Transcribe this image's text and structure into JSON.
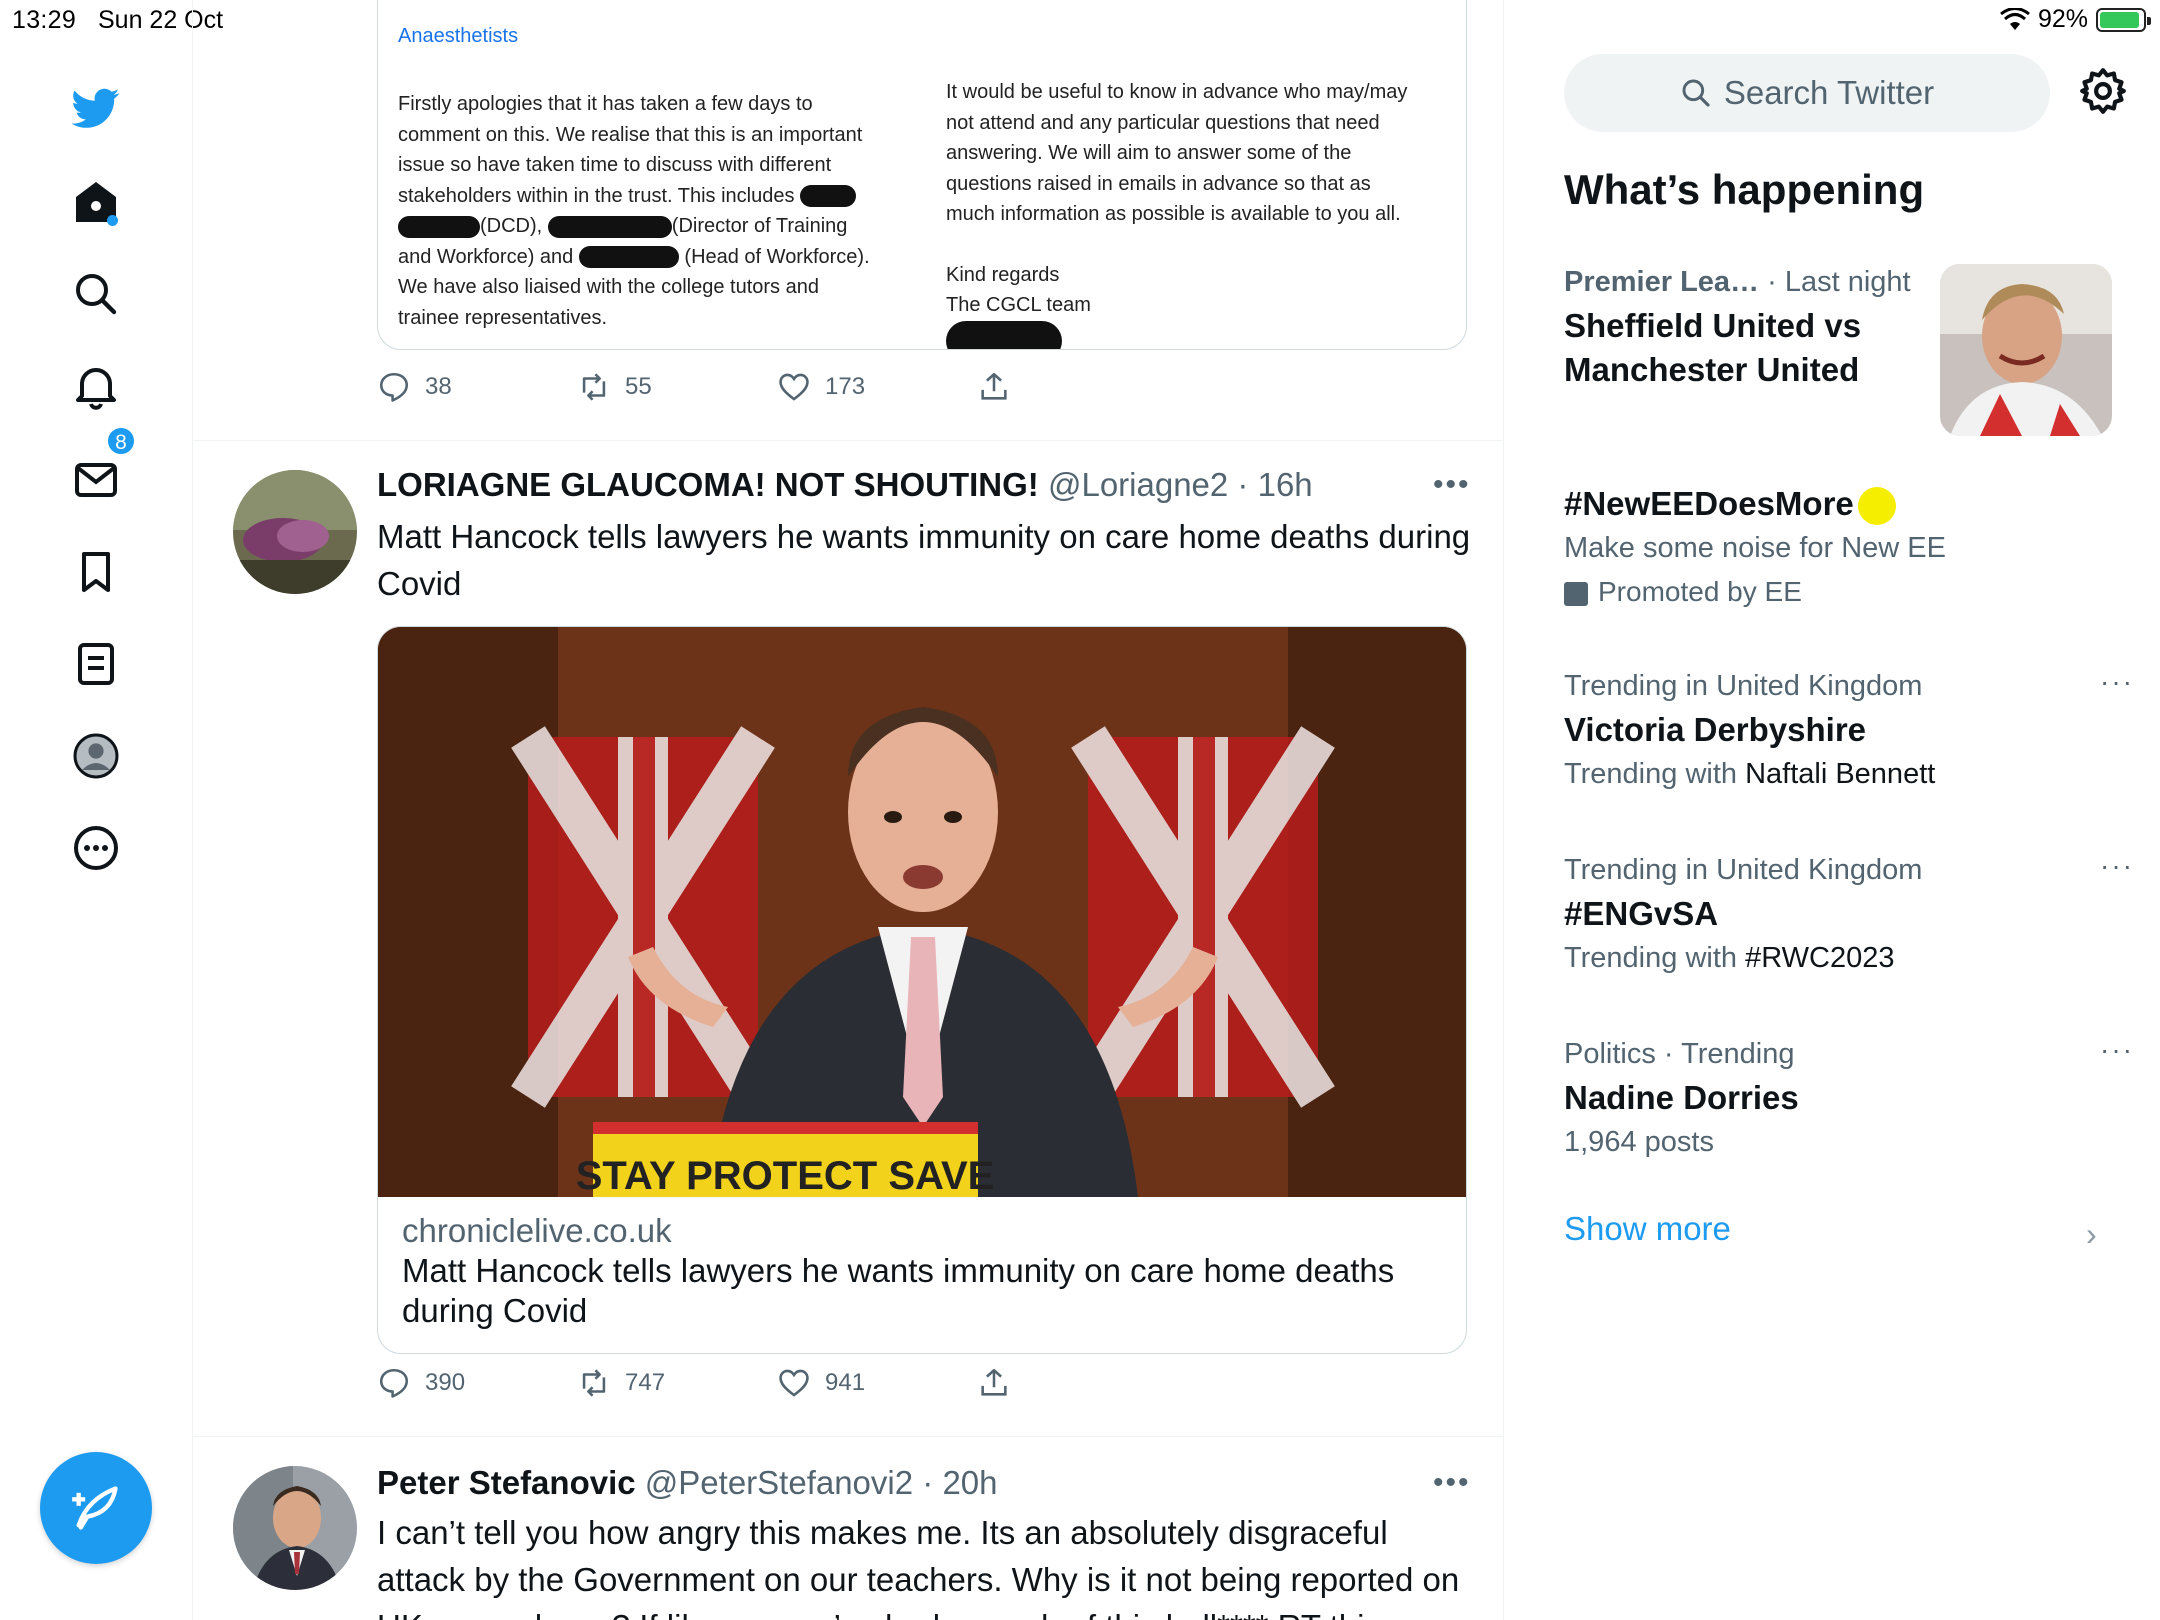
{
  "status_bar": {
    "time": "13:29",
    "date": "Sun 22 Oct",
    "battery": "92%"
  },
  "nav": {
    "notifications_badge": "8"
  },
  "doc": {
    "cut_top_left": "Anaesthetists",
    "left_1": "Firstly apologies that it has taken a few days to",
    "left_2": "comment on this. We realise that this is an important",
    "left_3": "issue so have taken time to discuss with different",
    "left_4": "stakeholders within in the trust. This includes",
    "left_5a": "(DCD),",
    "left_5b": "(Director of Training",
    "left_6a": "and Workforce) and",
    "left_6b": "(Head of Workforce).",
    "left_7": "We have also liaised with the college tutors and",
    "left_8": "trainee representatives.",
    "right_1": "It would be useful to know in advance who may/may",
    "right_2": "not attend and any particular questions that need",
    "right_3": "answering. We will aim to answer some of the",
    "right_4": "questions raised in emails in advance so that as",
    "right_5": "much information as possible is available to you all.",
    "right_6": "Kind regards",
    "right_7": "The CGCL team"
  },
  "tweet1_actions": {
    "replies": "38",
    "retweets": "55",
    "likes": "173"
  },
  "tweet2": {
    "name": "LORIAGNE GLAUCOMA! NOT SHOUTING!",
    "handle": "@Loriagne2",
    "time": "16h",
    "text": "Matt Hancock tells lawyers he wants immunity on care home deaths during Covid",
    "link_domain": "chroniclelive.co.uk",
    "link_title": "Matt Hancock tells lawyers he wants immunity on care home deaths during Covid",
    "podium_text": "STAY   PROTECT   SAVE",
    "replies": "390",
    "retweets": "747",
    "likes": "941"
  },
  "tweet3": {
    "name": "Peter Stefanovic",
    "handle": "@PeterStefanovi2",
    "time": "20h",
    "text": "I can’t tell you how angry this makes me. Its an absolutely disgraceful attack by the Government on our teachers. Why is it not being reported on UK news shows? If like me you’ve had enough of this bull**** RT this"
  },
  "sidebar": {
    "search_placeholder": "Search Twitter",
    "whats_happening": "What’s happening",
    "trends": [
      {
        "meta_cat": "Premier Lea…",
        "meta_time": "· Last night",
        "title": "Sheffield United vs Manchester United"
      },
      {
        "title": "#NewEEDoesMore",
        "sub": "Make some noise for New EE",
        "promo": "Promoted by EE"
      },
      {
        "meta": "Trending in United Kingdom",
        "title": "Victoria Derbyshire",
        "sub_prefix": "Trending with ",
        "sub_hl": "Naftali Bennett"
      },
      {
        "meta": "Trending in United Kingdom",
        "title": "#ENGvSA",
        "sub_prefix": "Trending with ",
        "sub_hl": "#RWC2023"
      },
      {
        "meta": "Politics · Trending",
        "title": "Nadine Dorries",
        "sub": "1,964 posts"
      }
    ],
    "more_dots": "···",
    "show_more": "Show more"
  },
  "colors": {
    "accent": "#1d9bf0",
    "text": "#0f1419",
    "muted": "#536471",
    "border": "#cfd9de"
  }
}
